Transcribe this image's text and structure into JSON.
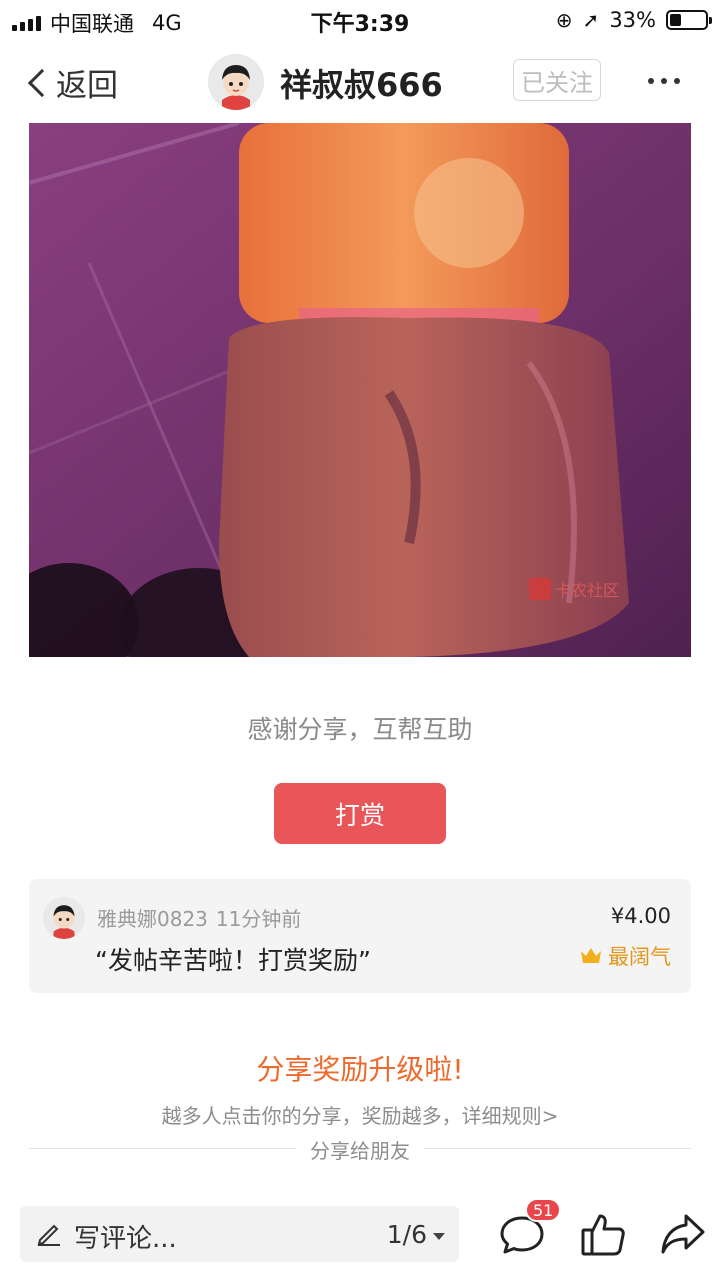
{
  "status_bar": {
    "carrier": "中国联通",
    "network": "4G",
    "time": "下午3:39",
    "battery_percent_text": "33%",
    "battery_level": 0.33
  },
  "nav": {
    "back_label": "返回",
    "username": "祥叔叔666",
    "follow_label": "已关注"
  },
  "post": {
    "photo_icon": "photo-of-orange-drink-bottle",
    "watermark": "卡农社区",
    "caption": "感谢分享，互帮互助",
    "reward_button": "打赏"
  },
  "reward": {
    "user": "雅典娜0823",
    "time": "11分钟前",
    "message": "“发帖辛苦啦！打赏奖励”",
    "amount": "¥4.00",
    "badge": "最阔气"
  },
  "share": {
    "title": "分享奖励升级啦!",
    "description": "越多人点击你的分享，奖励越多，详细规则>",
    "friends_label": "分享给朋友"
  },
  "bottom_bar": {
    "comment_placeholder": "写评论...",
    "page_indicator": "1/6",
    "comment_count": "51"
  },
  "colors": {
    "accent_red": "#e8565a",
    "share_orange": "#ec6a2c",
    "badge_gold": "#e2961b"
  }
}
